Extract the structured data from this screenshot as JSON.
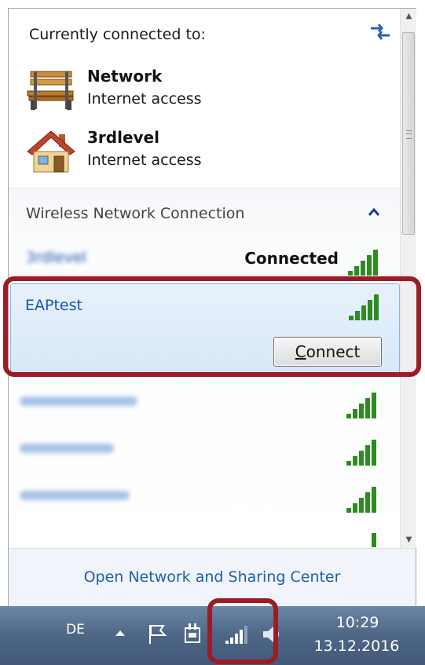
{
  "flyout": {
    "connected_title": "Currently connected to:",
    "connected_networks": [
      {
        "name": "Network",
        "status": "Internet access",
        "icon": "park-bench-icon"
      },
      {
        "name": "3rdlevel",
        "status": "Internet access",
        "icon": "house-icon"
      }
    ],
    "section_title": "Wireless Network Connection",
    "wireless_networks": [
      {
        "name": "3rdlevel",
        "status": "Connected",
        "blurred": true
      },
      {
        "name": "EAPtest",
        "status": "",
        "selected": true,
        "button": "Connect",
        "button_mnemonic": "C",
        "button_rest": "onnect"
      },
      {
        "name": "",
        "blurred": true
      },
      {
        "name": "",
        "blurred": true
      },
      {
        "name": "",
        "blurred": true
      }
    ],
    "footer_link": "Open Network and Sharing Center"
  },
  "taskbar": {
    "language": "DE",
    "time": "10:29",
    "date": "13.12.2016"
  },
  "colors": {
    "highlight": "#9b1c24",
    "link": "#1f5ea8",
    "signal": "#2e8b22"
  }
}
